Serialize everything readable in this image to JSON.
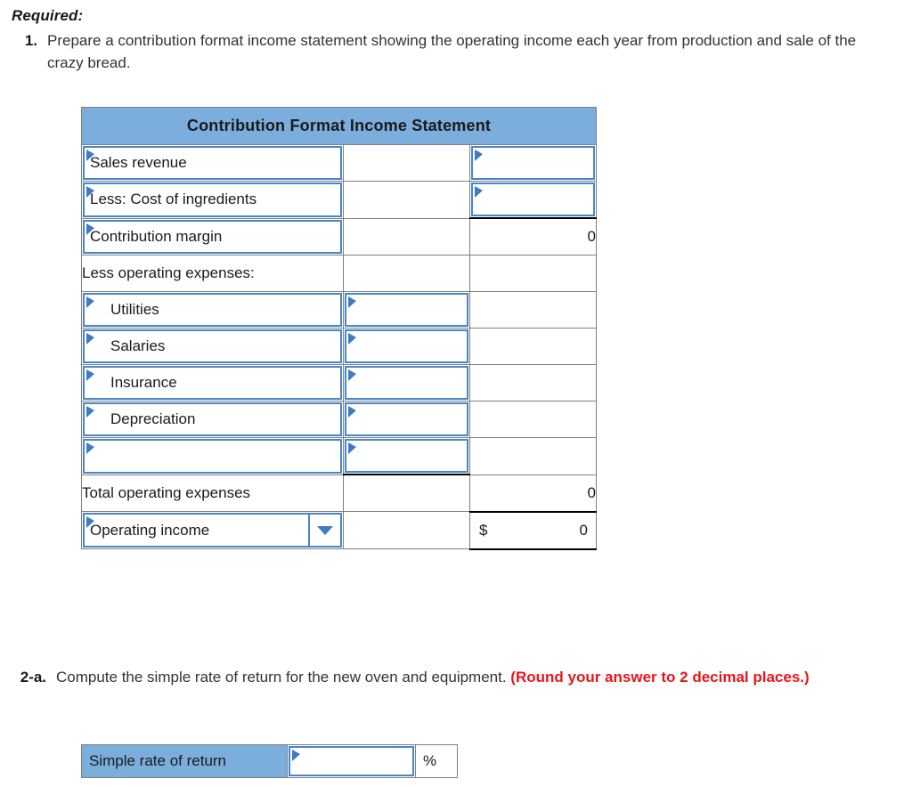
{
  "prompt": {
    "required_label": "Required:",
    "q1": {
      "number": "1.",
      "text": "Prepare a contribution format income statement showing the operating income each year from production and sale of the crazy bread."
    },
    "q2a": {
      "number": "2-a.",
      "text": "Compute the simple rate of return for the new oven and equipment. ",
      "red_text": "(Round your answer to 2 decimal places.)"
    }
  },
  "statement": {
    "title": "Contribution Format Income Statement",
    "rows": [
      {
        "label": "Sales revenue",
        "mid": "",
        "right": ""
      },
      {
        "label": "Less: Cost of ingredients",
        "mid": "",
        "right": ""
      },
      {
        "label": "Contribution margin",
        "mid": "",
        "right": "0"
      },
      {
        "label": "Less operating expenses:",
        "mid": "",
        "right": ""
      },
      {
        "label": "Utilities",
        "mid": "",
        "right": ""
      },
      {
        "label": "Salaries",
        "mid": "",
        "right": ""
      },
      {
        "label": "Insurance",
        "mid": "",
        "right": ""
      },
      {
        "label": "Depreciation",
        "mid": "",
        "right": ""
      },
      {
        "label": "",
        "mid": "",
        "right": ""
      },
      {
        "label": "Total operating expenses",
        "mid": "",
        "right": "0"
      },
      {
        "label": "Operating income",
        "mid": "",
        "right": "0",
        "currency": "$"
      }
    ]
  },
  "simple_rate_of_return": {
    "label": "Simple rate of return",
    "value": "",
    "placeholder": "",
    "unit": "%"
  },
  "colors": {
    "header_blue": "#7BAEDC",
    "input_border_blue": "#4A86C5",
    "flag_blue": "#3F7BC0",
    "grid_gray": "#808080",
    "red_note": "#e8161a"
  }
}
